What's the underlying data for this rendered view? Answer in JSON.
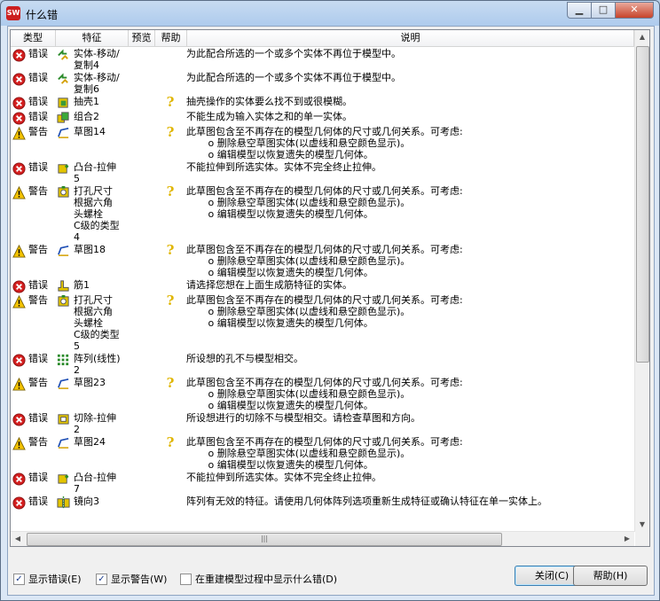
{
  "window": {
    "title": "什么错",
    "app_badge": "SW"
  },
  "columns": {
    "type": "类型",
    "feature": "特征",
    "preview": "预览",
    "help": "帮助",
    "description": "说明"
  },
  "rows": [
    {
      "severity": "error",
      "label": "错误",
      "feature": "实体-移动/\n复制4",
      "feature_icon": "move-copy-icon",
      "help": false,
      "description": "为此配合所选的一个或多个实体不再位于模型中。"
    },
    {
      "severity": "error",
      "label": "错误",
      "feature": "实体-移动/\n复制6",
      "feature_icon": "move-copy-icon",
      "help": false,
      "description": "为此配合所选的一个或多个实体不再位于模型中。"
    },
    {
      "severity": "error",
      "label": "错误",
      "feature": "抽壳1",
      "feature_icon": "shell-icon",
      "help": true,
      "description": "抽壳操作的实体要么找不到或很模糊。"
    },
    {
      "severity": "error",
      "label": "错误",
      "feature": "组合2",
      "feature_icon": "combine-icon",
      "help": false,
      "description": "不能生成为输入实体之和的单一实体。"
    },
    {
      "severity": "warning",
      "label": "警告",
      "feature": "草图14",
      "feature_icon": "sketch-icon",
      "help": true,
      "description": "此草图包含至不再存在的模型几何体的尺寸或几何关系。可考虑:\n       o 删除悬空草图实体(以虚线和悬空颜色显示)。\n       o 编辑模型以恢复遗失的模型几何体。"
    },
    {
      "severity": "error",
      "label": "错误",
      "feature": "凸台-拉伸\n5",
      "feature_icon": "boss-extrude-icon",
      "help": false,
      "description": "不能拉伸到所选实体。实体不完全终止拉伸。"
    },
    {
      "severity": "warning",
      "label": "警告",
      "feature": "打孔尺寸\n根据六角\n头螺栓\nC级的类型\n4",
      "feature_icon": "hole-wizard-icon",
      "help": true,
      "description": "此草图包含至不再存在的模型几何体的尺寸或几何关系。可考虑:\n       o 删除悬空草图实体(以虚线和悬空颜色显示)。\n       o 编辑模型以恢复遗失的模型几何体。"
    },
    {
      "severity": "warning",
      "label": "警告",
      "feature": "草图18",
      "feature_icon": "sketch-icon",
      "help": true,
      "description": "此草图包含至不再存在的模型几何体的尺寸或几何关系。可考虑:\n       o 删除悬空草图实体(以虚线和悬空颜色显示)。\n       o 编辑模型以恢复遗失的模型几何体。"
    },
    {
      "severity": "error",
      "label": "错误",
      "feature": "筋1",
      "feature_icon": "rib-icon",
      "help": false,
      "description": "请选择您想在上面生成筋特征的实体。"
    },
    {
      "severity": "warning",
      "label": "警告",
      "feature": "打孔尺寸\n根据六角\n头螺栓\nC级的类型\n5",
      "feature_icon": "hole-wizard-icon",
      "help": true,
      "description": "此草图包含至不再存在的模型几何体的尺寸或几何关系。可考虑:\n       o 删除悬空草图实体(以虚线和悬空颜色显示)。\n       o 编辑模型以恢复遗失的模型几何体。"
    },
    {
      "severity": "error",
      "label": "错误",
      "feature": "阵列(线性)\n2",
      "feature_icon": "linear-pattern-icon",
      "help": false,
      "description": "所设想的孔不与模型相交。"
    },
    {
      "severity": "warning",
      "label": "警告",
      "feature": "草图23",
      "feature_icon": "sketch-icon",
      "help": true,
      "description": "此草图包含至不再存在的模型几何体的尺寸或几何关系。可考虑:\n       o 删除悬空草图实体(以虚线和悬空颜色显示)。\n       o 编辑模型以恢复遗失的模型几何体。"
    },
    {
      "severity": "error",
      "label": "错误",
      "feature": "切除-拉伸\n2",
      "feature_icon": "cut-extrude-icon",
      "help": false,
      "description": "所设想进行的切除不与模型相交。请检查草图和方向。"
    },
    {
      "severity": "warning",
      "label": "警告",
      "feature": "草图24",
      "feature_icon": "sketch-icon",
      "help": true,
      "description": "此草图包含至不再存在的模型几何体的尺寸或几何关系。可考虑:\n       o 删除悬空草图实体(以虚线和悬空颜色显示)。\n       o 编辑模型以恢复遗失的模型几何体。"
    },
    {
      "severity": "error",
      "label": "错误",
      "feature": "凸台-拉伸\n7",
      "feature_icon": "boss-extrude-icon",
      "help": false,
      "description": "不能拉伸到所选实体。实体不完全终止拉伸。"
    },
    {
      "severity": "error",
      "label": "错误",
      "feature": "镜向3",
      "feature_icon": "mirror-icon",
      "help": false,
      "description": "阵列有无效的特征。请使用几何体阵列选项重新生成特征或确认特征在单一实体上。"
    }
  ],
  "options": {
    "show_errors": {
      "label": "显示错误(E)",
      "checked": true
    },
    "show_warnings": {
      "label": "显示警告(W)",
      "checked": true
    },
    "show_during_rebuild": {
      "label": "在重建模型过程中显示什么错(D)",
      "checked": false
    }
  },
  "buttons": {
    "close": "关闭(C)",
    "help": "帮助(H)"
  },
  "colors": {
    "error": "#d42020",
    "warning": "#f5c400",
    "help": "#e0b500",
    "titlebar": "#aecbed",
    "default_button_border": "#3c7fb1"
  }
}
